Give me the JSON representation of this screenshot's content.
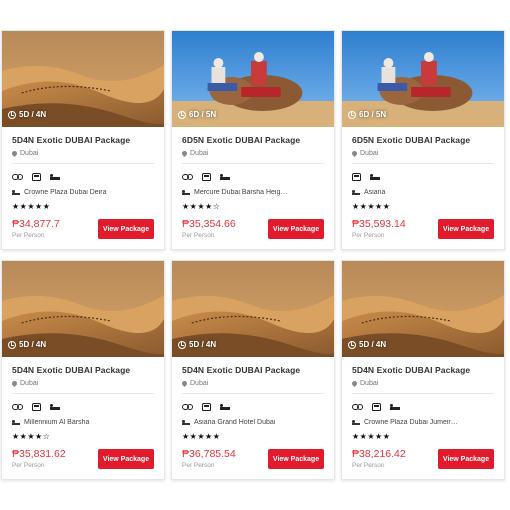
{
  "colors": {
    "accent": "#e21b2c",
    "price": "#e8333c"
  },
  "cards": [
    {
      "image": "desert-caravan",
      "duration": "5D / 4N",
      "title": "5D4N Exotic DUBAI Package",
      "location": "Dubai",
      "amenities": [
        "binoculars-icon",
        "car-icon",
        "bed-icon"
      ],
      "hotel": "Crowne Plaza Dubai Deira",
      "stars": "★★★★★",
      "price": "₱34,877.7",
      "per": "Per Person",
      "button": "View Package"
    },
    {
      "image": "camel-riders",
      "duration": "6D / 5N",
      "title": "6D5N Exotic DUBAI Package",
      "location": "Dubai",
      "amenities": [
        "binoculars-icon",
        "car-icon",
        "bed-icon"
      ],
      "hotel": "Mercure Dubai Barsha Heig…",
      "stars": "★★★★☆",
      "price": "₱35,354.66",
      "per": "Per Person",
      "button": "View Package"
    },
    {
      "image": "camel-riders",
      "duration": "6D / 5N",
      "title": "6D5N Exotic DUBAI Package",
      "location": "Dubai",
      "amenities": [
        "car-icon",
        "bed-icon"
      ],
      "hotel": "Asiana",
      "stars": "★★★★★",
      "price": "₱35,593.14",
      "per": "Per Person",
      "button": "View Package"
    },
    {
      "image": "desert-caravan",
      "duration": "5D / 4N",
      "title": "5D4N Exotic DUBAI Package",
      "location": "Dubai",
      "amenities": [
        "binoculars-icon",
        "car-icon",
        "bed-icon"
      ],
      "hotel": "Millennium Al Barsha",
      "stars": "★★★★☆",
      "price": "₱35,831.62",
      "per": "Per Person",
      "button": "View Package"
    },
    {
      "image": "desert-caravan",
      "duration": "5D / 4N",
      "title": "5D4N Exotic DUBAI Package",
      "location": "Dubai",
      "amenities": [
        "binoculars-icon",
        "car-icon",
        "bed-icon"
      ],
      "hotel": "Asiana Grand Hotel Dubai",
      "stars": "★★★★★",
      "price": "₱36,785.54",
      "per": "Per Person",
      "button": "View Package"
    },
    {
      "image": "desert-caravan",
      "duration": "5D / 4N",
      "title": "5D4N Exotic DUBAI Package",
      "location": "Dubai",
      "amenities": [
        "binoculars-icon",
        "car-icon",
        "bed-icon"
      ],
      "hotel": "Crowne Plaza Dubai Jumeir…",
      "stars": "★★★★★",
      "price": "₱38,216.42",
      "per": "Per Person",
      "button": "View Package"
    }
  ]
}
